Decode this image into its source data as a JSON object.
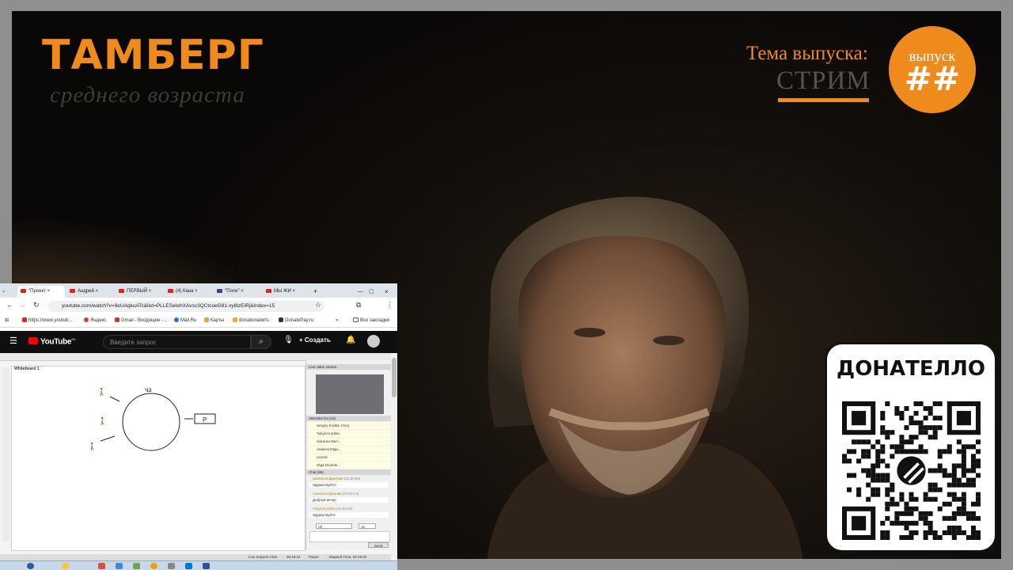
{
  "brand": {
    "title": "ТАМБЕРГ",
    "subtitle": "среднего возраста"
  },
  "topic": {
    "label": "Тема выпуска:",
    "value": "СТРИМ"
  },
  "episode": {
    "label": "выпуск",
    "number": "##"
  },
  "donate": {
    "title": "ДОНАТЕЛЛО"
  },
  "browser": {
    "tabs": [
      "\"Проект",
      "Андрей",
      "ПЕРВЫЙ",
      "(4) Кана",
      "\"Поле\"",
      "МЫ ЖИ"
    ],
    "url": "youtube.com/watch?v=9eUAqkuATc&list=PLLESeIehXAvsc3QCtcoeG81-xy8IzEiRj&index=15",
    "bookmarks": [
      "https://www.youtub...",
      "Яндекс",
      "Gmail - Входящие -...",
      "Mail.Ru",
      "Карты",
      "donationalerts",
      "DonatePay.ru",
      "Все закладки"
    ],
    "youtube": {
      "logo": "YouTube",
      "region": "RU",
      "search_placeholder": "Введите запрос",
      "create_label": "Создать"
    },
    "video": {
      "whiteboard_label": "Whiteboard 1",
      "drawing_label": "ча",
      "box_label": "P",
      "live_stream_label": "Live video stream",
      "attendee_list_label": "Attendee list (15)",
      "attendees": [
        "Sergey Krotkin (You)",
        "Yuliya Kurdina",
        "Наталья Бел...",
        "Анжела Юди...",
        "Leonid",
        "Olga Dvornik..."
      ],
      "chat_label": "Chat (86)",
      "chat": [
        {
          "name": "Шипилов Дмитрий",
          "time": "(21:52:55)",
          "msg": "Здравствуйте!"
        },
        {
          "name": "Анжела Юдинова",
          "time": "(21:53:14)",
          "msg": "Добрый вечер"
        },
        {
          "name": "Yuliya Kurdina",
          "time": "(21:53:20)",
          "msg": "Здравствуйте"
        }
      ],
      "chat_to": "All",
      "font_size": "12",
      "send_label": "Send",
      "status_support": "Live Support Chat",
      "status_time": "00:19:24",
      "status_pause": "Pause",
      "status_elapsed": "Elapsed Time: 00:19:03"
    }
  }
}
